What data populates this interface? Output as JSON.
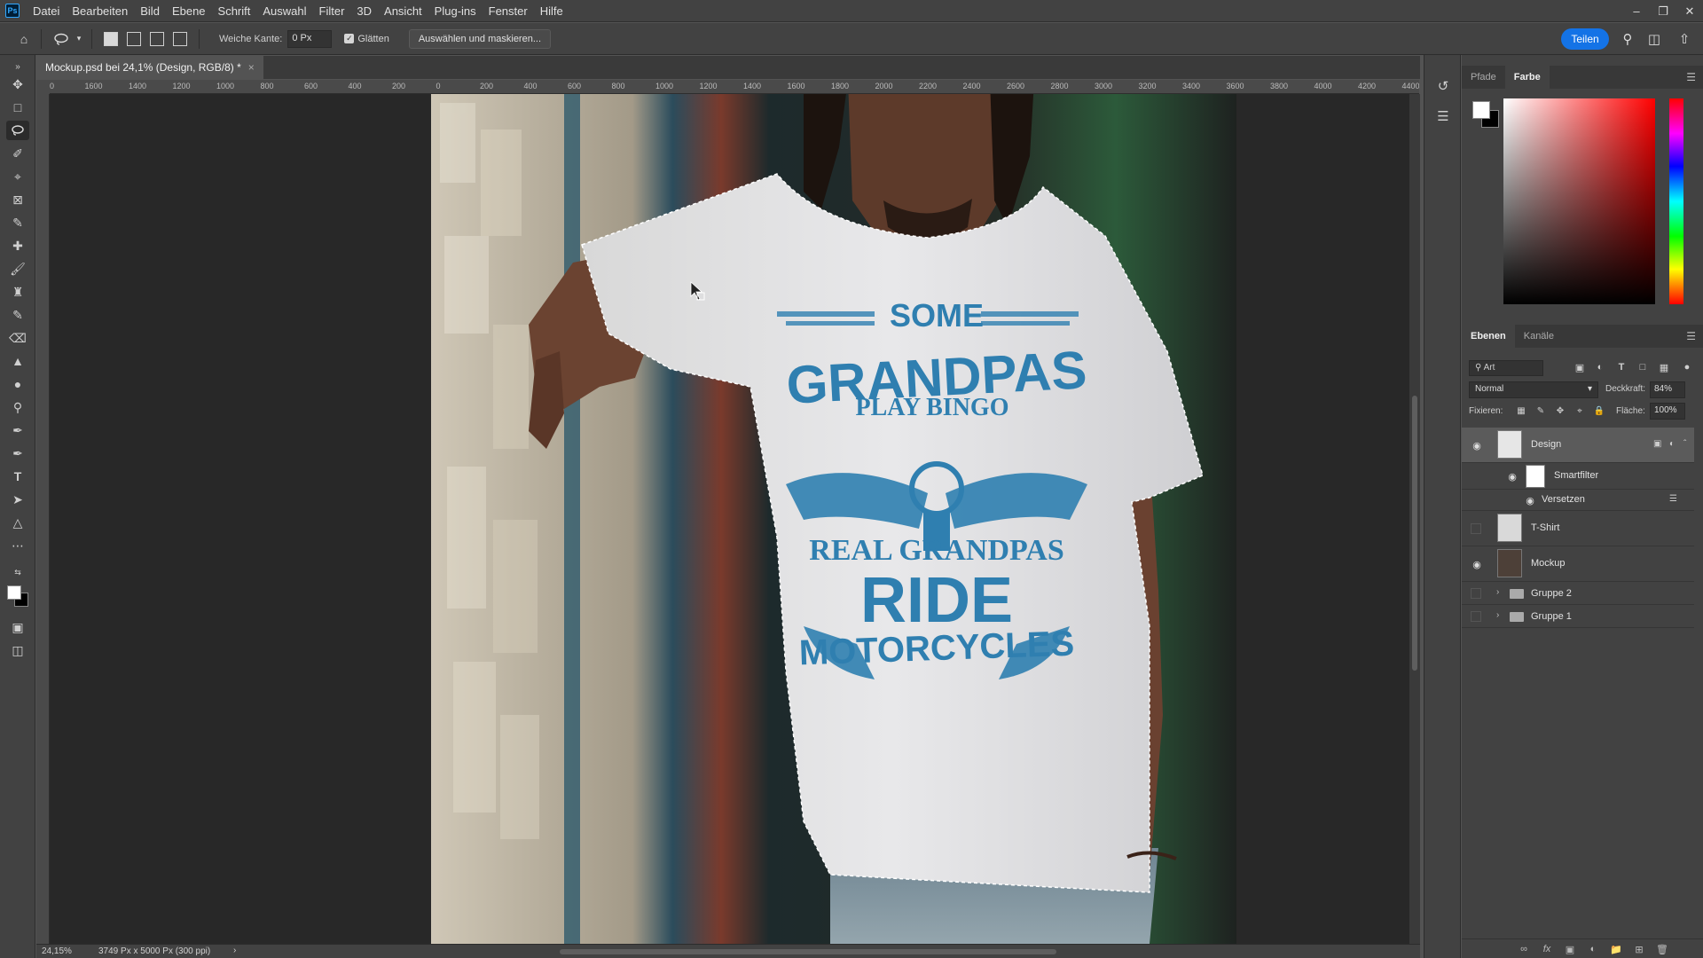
{
  "app": {
    "logo": "Ps",
    "menu": [
      "Datei",
      "Bearbeiten",
      "Bild",
      "Ebene",
      "Schrift",
      "Auswahl",
      "Filter",
      "3D",
      "Ansicht",
      "Plug-ins",
      "Fenster",
      "Hilfe"
    ],
    "window_icons": [
      "minimize-icon",
      "restore-icon",
      "close-icon"
    ]
  },
  "options": {
    "feather_label": "Weiche Kante:",
    "feather_value": "0 Px",
    "smooth_label": "Glätten",
    "select_mask_label": "Auswählen und maskieren...",
    "share_label": "Teilen"
  },
  "document": {
    "tab_title": "Mockup.psd bei 24,1% (Design, RGB/8) *",
    "zoom": "24,15%",
    "size_info": "3749 Px x 5000 Px (300 ppi)"
  },
  "ruler_h_labels": [
    "800",
    "1600",
    "1400",
    "1200",
    "1000",
    "800",
    "600",
    "400",
    "200",
    "0",
    "200",
    "400",
    "600",
    "800",
    "1000",
    "1200",
    "1400",
    "1600",
    "1800",
    "2000",
    "2200",
    "2400",
    "2600",
    "2800",
    "3000",
    "3200",
    "3400",
    "3600",
    "3800",
    "4000",
    "4200",
    "4400"
  ],
  "color_panel": {
    "tabs": [
      "Pfade",
      "Farbe"
    ],
    "active_tab": "Farbe",
    "foreground": "#ffffff",
    "background": "#000000"
  },
  "layers_panel": {
    "tabs": [
      "Ebenen",
      "Kanäle"
    ],
    "active_tab": "Ebenen",
    "search_placeholder": "Art",
    "blend_mode": "Normal",
    "opacity_label": "Deckkraft:",
    "opacity": "84%",
    "lock_label": "Fixieren:",
    "fill_label": "Fläche:",
    "fill": "100%",
    "layers": [
      {
        "name": "Design",
        "visible": true,
        "selected": true,
        "kind": "smart-object"
      },
      {
        "name": "Smartfilter",
        "visible": true,
        "kind": "smart-filter"
      },
      {
        "name": "Versetzen",
        "visible": true,
        "kind": "filter"
      },
      {
        "name": "T-Shirt",
        "visible": false,
        "kind": "layer"
      },
      {
        "name": "Mockup",
        "visible": true,
        "kind": "layer"
      },
      {
        "name": "Gruppe 2",
        "visible": false,
        "kind": "group"
      },
      {
        "name": "Gruppe 1",
        "visible": false,
        "kind": "group"
      }
    ]
  },
  "canvas": {
    "shirt_print": {
      "line1": "SOME",
      "line2": "GRANDPAS",
      "line3": "PLAY BINGO",
      "line4": "REAL GRANDPAS",
      "line5": "RIDE",
      "line6": "MOTORCYCLES"
    },
    "print_color": "#2f7fb0"
  }
}
